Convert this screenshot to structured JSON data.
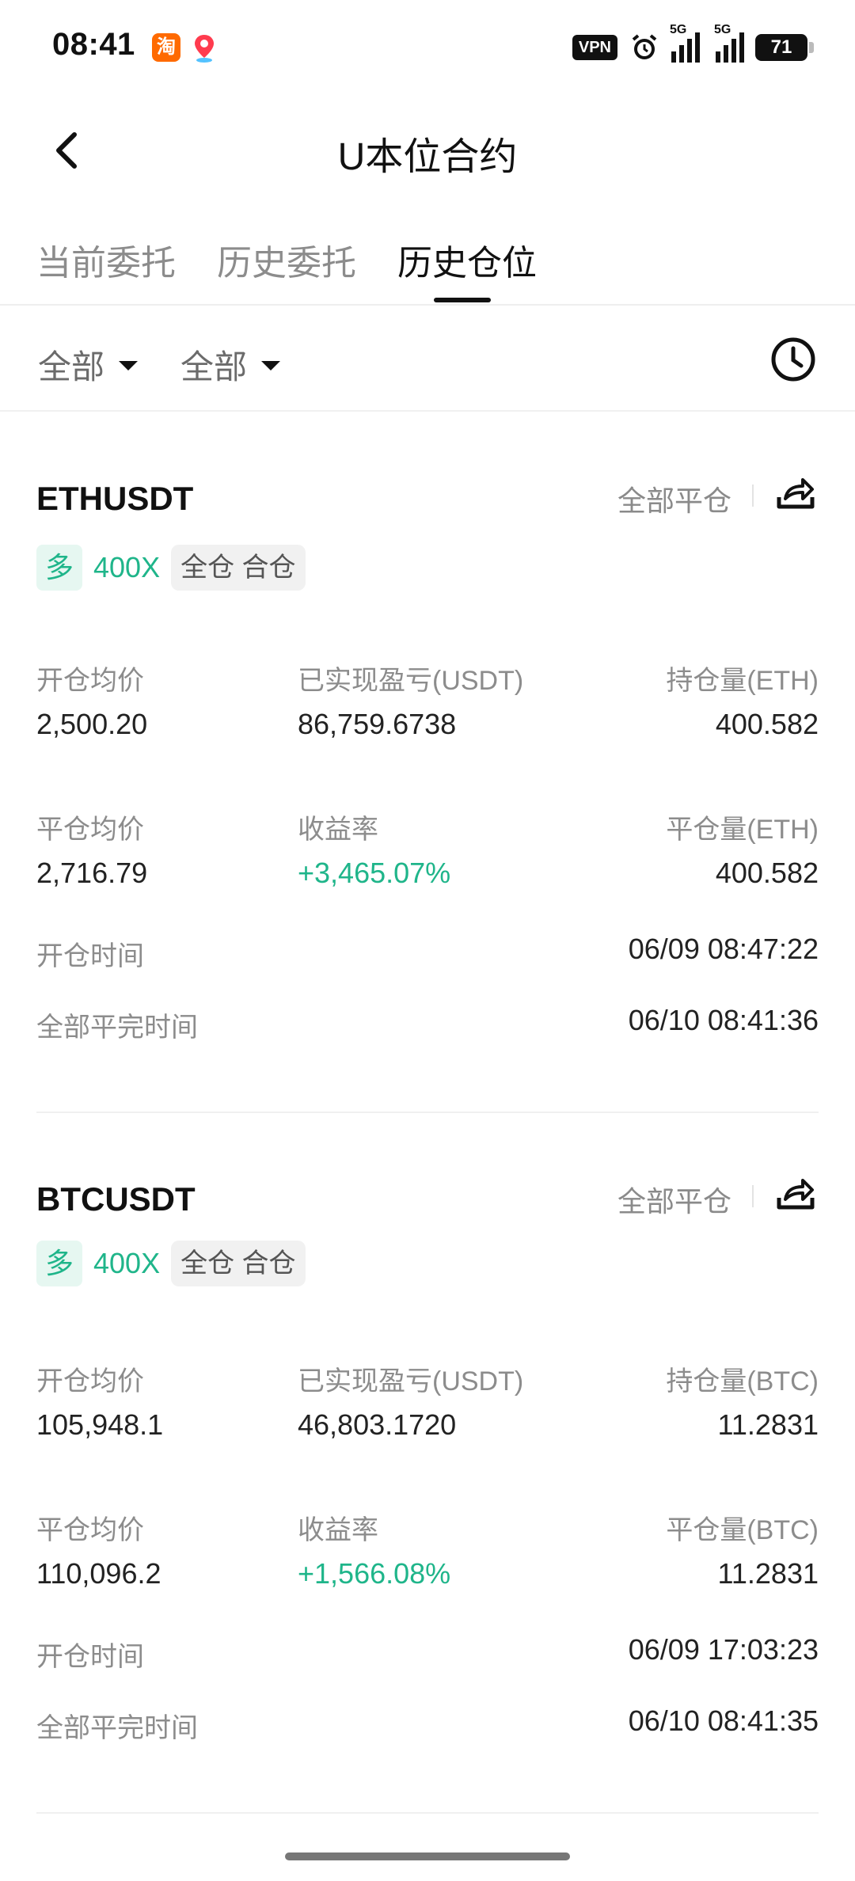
{
  "status": {
    "time": "08:41",
    "app1_glyph": "淘",
    "vpn": "VPN",
    "net1": "5G",
    "net2": "5G",
    "battery": "71"
  },
  "header": {
    "title": "U本位合约"
  },
  "tabs": [
    {
      "label": "当前委托"
    },
    {
      "label": "历史委托"
    },
    {
      "label": "历史仓位"
    }
  ],
  "filters": [
    {
      "label": "全部"
    },
    {
      "label": "全部"
    }
  ],
  "positions": [
    {
      "symbol": "ETHUSDT",
      "close_all": "全部平仓",
      "direction": "多",
      "leverage": "400X",
      "mode": "全仓 合仓",
      "labels": {
        "open_avg": "开仓均价",
        "realized_pnl": "已实现盈亏(USDT)",
        "holding": "持仓量(ETH)",
        "close_avg": "平仓均价",
        "roi": "收益率",
        "closed_qty": "平仓量(ETH)",
        "open_time": "开仓时间",
        "close_time": "全部平完时间"
      },
      "values": {
        "open_avg": "2,500.20",
        "realized_pnl": "86,759.6738",
        "holding": "400.582",
        "close_avg": "2,716.79",
        "roi": "+3,465.07%",
        "closed_qty": "400.582",
        "open_time": "06/09 08:47:22",
        "close_time": "06/10 08:41:36"
      }
    },
    {
      "symbol": "BTCUSDT",
      "close_all": "全部平仓",
      "direction": "多",
      "leverage": "400X",
      "mode": "全仓 合仓",
      "labels": {
        "open_avg": "开仓均价",
        "realized_pnl": "已实现盈亏(USDT)",
        "holding": "持仓量(BTC)",
        "close_avg": "平仓均价",
        "roi": "收益率",
        "closed_qty": "平仓量(BTC)",
        "open_time": "开仓时间",
        "close_time": "全部平完时间"
      },
      "values": {
        "open_avg": "105,948.1",
        "realized_pnl": "46,803.1720",
        "holding": "11.2831",
        "close_avg": "110,096.2",
        "roi": "+1,566.08%",
        "closed_qty": "11.2831",
        "open_time": "06/09 17:03:23",
        "close_time": "06/10 08:41:35"
      }
    }
  ],
  "colors": {
    "accent_green": "#1fb58a",
    "muted_text": "#8c8c8c"
  }
}
